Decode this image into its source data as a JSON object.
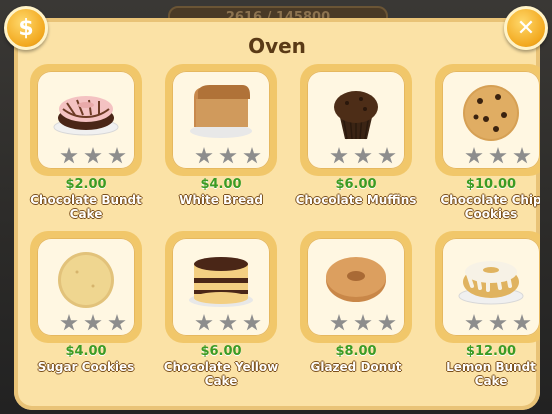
{
  "xp": {
    "text": "2616 / 145800"
  },
  "title": "Oven",
  "buttons": {
    "currency_glyph": "$",
    "close_glyph": "✕"
  },
  "items": [
    {
      "price": "$2.00",
      "name": "Chocolate Bundt Cake",
      "art": "bundt-chocolate"
    },
    {
      "price": "$4.00",
      "name": "White Bread",
      "art": "bread"
    },
    {
      "price": "$6.00",
      "name": "Chocolate Muffins",
      "art": "muffin"
    },
    {
      "price": "$10.00",
      "name": "Chocolate Chip Cookies",
      "art": "cookie-chip"
    },
    {
      "price": "$4.00",
      "name": "Sugar Cookies",
      "art": "cookie-sugar"
    },
    {
      "price": "$6.00",
      "name": "Chocolate Yellow Cake",
      "art": "layer-cake"
    },
    {
      "price": "$8.00",
      "name": "Glazed Donut",
      "art": "donut"
    },
    {
      "price": "$12.00",
      "name": "Lemon Bundt Cake",
      "art": "bundt-lemon"
    }
  ]
}
